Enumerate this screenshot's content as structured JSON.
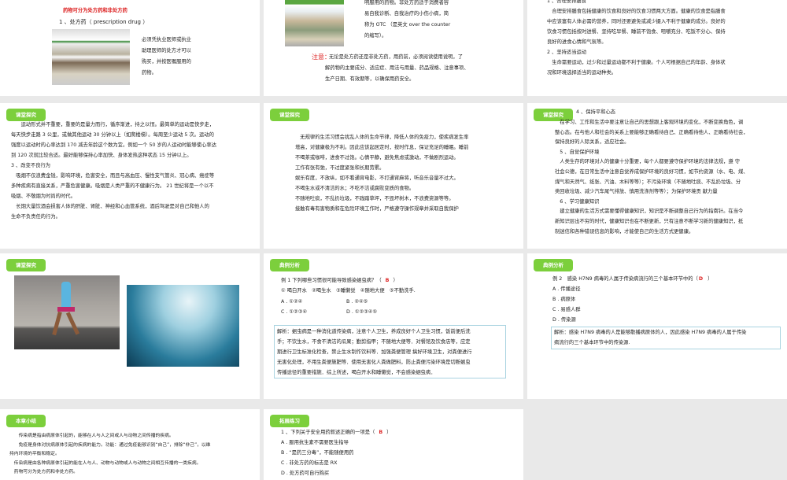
{
  "slides": [
    {
      "title": "药物可分为处方药和非处方药",
      "subtitle": "1 、处方药（ prescription drug ）",
      "lines": [
        "必须凭执业医师或执业",
        "助理医师的处方才可以",
        "购买，并按医嘱服用的",
        "药物。"
      ]
    },
    {
      "lines": [
        "明服用的药物。非处方药适于消费者容",
        "易自我诊断、自我治疗的小伤小病，简",
        "称为 OTC （是英文 over the counter",
        "的缩写）。"
      ],
      "note_label": "注意：",
      "note_lines": [
        "无论是处方药还是非处方药，用药前，必须阅读使用说明，了",
        "解药物的主要成分、适应症、用法与用量、药品规格、注意事项、",
        "生产日期、有效期等，以确保用药安全。"
      ]
    },
    {
      "lines": [
        "1 、合理安排膳食",
        "　合理安排膳食包括健康的饮食和良好的饮食习惯两大方面。健康的饮食是指膳食",
        "中应该富有人体必需的营养，同时还要避免或减少摄入不利于健康的成分。良好的",
        "饮食习惯包括按时进餐、坚持吃早餐、睡前不饱食、咀嚼充分、吃饭不分心、保持",
        "良好的进食心情和气氛等。",
        "2 、坚持适当运动",
        "　生命需要运动，过少和过量运动都不利于健康。个人可根据自己的年龄、身体状",
        "况和环境选择适当的运动种类。"
      ]
    },
    {
      "badge": "课堂探究",
      "lines": [
        "　　运动形式并不重要，重要的是量力而行，循序渐进，持之以恒。最简单的运动是快步走，",
        "每天快步走路 3 公里，或做其他运动 30 分钟以上（如爬楼梯）。每周至少运动 5 次。运动的",
        "强度以运动时的心率达到 170 减去年龄这个数为宜。例如一个 50 岁的人运动时能够使心率达",
        "到 120 次就比较合适。最好能够保持心率加快、身体发热这种状态 15 分钟以上。",
        "3 、改变不良行为",
        "　吸烟不仅浪费金钱，影响环境，危害安全，而且与高血压、慢性支气管炎、冠心病、癌症等",
        "多种疾病有直接关系，严重危害健康。吸烟是人类严重的不健康行为。 21 世纪将是一个以不",
        "吸烟、不敬烟为时尚的时代。",
        "　长期大量饮酒会损害人体的肝脏、肾脏、神经和心血管系统，酒后驾驶是对自己和他人的",
        "生命不负责任的行为。"
      ]
    },
    {
      "badge": "课堂探究",
      "lines": [
        "　无规律的生活习惯会扰乱人体的生命节律，降低人体的免疫力，使疾病发生率",
        "增高，对健康极为不利。因此应该起居定时，按时作息，保证充足的睡眠。睡前",
        "不喝茶或咖啡，进食不过饱。心情平静，避免焦虑或激动，不做剧烈运动。",
        "工作有张有弛，不过度紧张和长期劳累。",
        "娱乐有度，不放纵，如不看通宵电影，不打通宵麻将，听音乐音量不过大。",
        "不喝生水或不清洁的水；不吃不洁或腐败变质的食物。",
        "不随地吐痰，不乱扔垃圾，不践踏草坪，不毁坏树木，不浪费资源等等。",
        "接触有毒有害物质和在危险环境工作时，严格遵守操作规章并采取自我保护"
      ]
    },
    {
      "badge": "课堂探究",
      "heading": "4 、保持平和心态",
      "lines": [
        "　在学习、工作和生活中要注意让自己的思想跟上客观环境的变化，不断变换角色，调",
        "整心态。在与他人和社会的关系上要能够正确看待自己、正确看待他人、正确看待社会，",
        "保持良好的人际关系，适应社会。",
        "　5 、自觉保护环境",
        "　人类生存的环境对人的健康十分重要，每个人都要遵守保护环境的法律法规，遵 守",
        "社会公德，在日常生活中注意自觉养成保护环境的良好习惯，如节约资源（水、电、煤、",
        "煤气和天然气、纸张、汽油、木料等等）；不污染环境（不随地吐痰、不乱扔垃圾、分",
        "类回收垃圾、减少汽车尾气排放、慎用洗涤剂等等）；为保护环境贡 献力量",
        "　6 、学习健康知识",
        "　建立健康的生活方式需要懂得健康知识，知识是不断调整自己行为的指南针。在当今",
        "新知识层出不穷的时代，健康知识也在不断更新，只有注意不断学习新的健康知识，抵",
        "制迷信和各种错误信息的影响，才能使自己的生活方式更健康。"
      ]
    },
    {
      "badge": "课堂探究"
    },
    {
      "badge": "典例分析",
      "question": "例 1 下列哪些习惯很可能导致感染蛔虫病？（",
      "answer": "B",
      "question_end": "）",
      "items": "① 喝白开水　②喝生水　③睡懒觉　④随地大便　⑤不勤洗手.",
      "options": [
        "A . ①②④",
        "B . ②④⑤",
        "C . ①②③④",
        "D . ①②③④⑤"
      ],
      "analysis": [
        "解析：蛔虫病是一种消化道传染病，注意个人卫生，养成良好个人卫生习惯，饭前便后洗",
        "手；不饮生水，不食不清洁的瓜果；勤剪指甲；不随地大便等．对餐馆及饮食店等，应定",
        "期进行卫生标准化检查，禁止生水制作饮料等．加强粪便管理 搞好环境卫生，对粪便进行",
        "无害化处理，不用生粪便施肥等．使用无害化人粪做肥料，防止粪便污染环境是切断蛔虫",
        "传播途径的重要措施．综上所述，喝白开水和睡懒觉，不会感染蛔虫病．"
      ]
    },
    {
      "badge": "典例分析",
      "question": "例 2　感染 H7N9 病毒的人属于传染病流行的三个基本环节中的（",
      "answer": "D",
      "question_end": "）",
      "options": [
        "A . 传播途径",
        "B . 病原体",
        "C . 易感人群",
        "D . 传染源"
      ],
      "analysis": [
        "解析：感染 H7N9 病毒的人是能够散播病原体的人，因此感染 H7N9 病毒的人属于传染",
        "病流行的三个基本环节中的传染源."
      ]
    },
    {
      "badge": "本章小结",
      "lines": [
        "　　传染病是指由病原体引起的，能够在人与人之间或人与动物之间传播的疾病。",
        "　　免疫是身体对抗病原体引起的疾病的能力。功能：通过免疫能够识别“自己”，排除“非己”，以维",
        "持内环境的平衡和稳定。",
        "　传染病是由各种病原体引起的能在人与人、动物与动物或人与动物之间相互传播的一类疾病。",
        "　药物可分为处方药和非处方药。"
      ]
    },
    {
      "badge": "拓展练习",
      "question": "1 、下列关于安全用药叙述正确的一项是（",
      "answer": "B",
      "question_end": "）",
      "options": [
        "A . 服用抗生素不需要医生指导",
        "B . “是药三分毒”，不能随便用药",
        "C . 非处方药的标志是 RX",
        "D . 处方药可自行购买"
      ]
    }
  ],
  "colors": {
    "badge": "#7ccf3c",
    "answer": "#cc1f1f",
    "background": "#e9e9e9"
  }
}
